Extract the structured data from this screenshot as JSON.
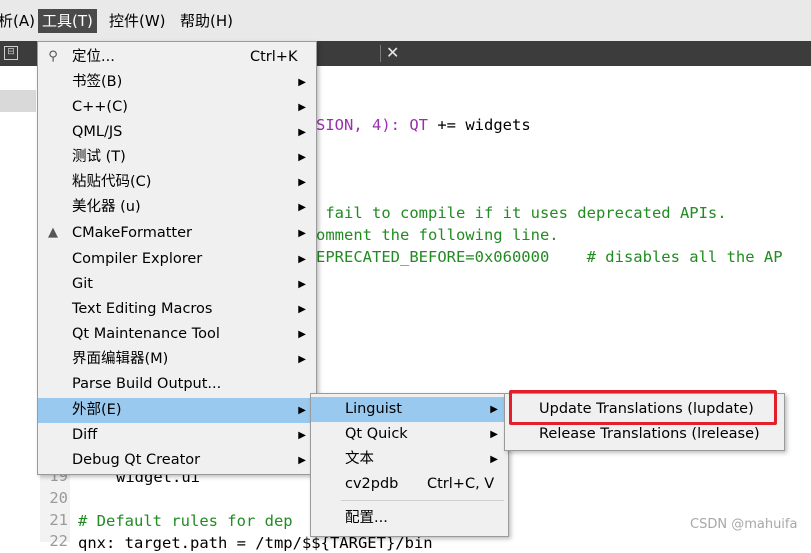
{
  "menubar": {
    "items": [
      {
        "label": "析(A)",
        "underline": "A",
        "active": false
      },
      {
        "label": "工具(T)",
        "underline": "T",
        "active": true
      },
      {
        "label": "控件(W)",
        "underline": "W",
        "active": false
      },
      {
        "label": "帮助(H)",
        "underline": "H",
        "active": false
      }
    ]
  },
  "tabbar": {
    "close_glyph": "✕",
    "split_glyph": "⊟"
  },
  "code": {
    "lines": [
      {
        "text_a": "SION, 4): ",
        "text_b": "QT",
        "text_c": " += widgets"
      },
      {
        "text": " fail to compile if it uses deprecated APIs."
      },
      {
        "text": "omment the following line."
      },
      {
        "text": "EPRECATED_BEFORE=0x060000    # disables all the AP"
      },
      {
        "text": "widget.ui"
      },
      {
        "text": "# Default rules for dep"
      },
      {
        "text": "qnx: target.path = /tmp/$${TARGET}/bin"
      }
    ],
    "line_numbers": [
      "19",
      "20",
      "21",
      "22"
    ]
  },
  "tools_menu": {
    "items": [
      {
        "label": "定位...",
        "shortcut": "Ctrl+K",
        "icon": "search-icon",
        "submenu": false
      },
      {
        "label": "书签(B)",
        "submenu": true
      },
      {
        "label": "C++(C)",
        "submenu": true
      },
      {
        "label": "QML/JS",
        "submenu": true
      },
      {
        "label": "测试 (T)",
        "submenu": true
      },
      {
        "label": "粘贴代码(C)",
        "submenu": true
      },
      {
        "label": "美化器 (u)",
        "submenu": true
      },
      {
        "label": "CMakeFormatter",
        "icon": "cmake-icon",
        "submenu": true
      },
      {
        "label": "Compiler Explorer",
        "submenu": true
      },
      {
        "label": "Git",
        "submenu": true
      },
      {
        "label": "Text Editing Macros",
        "submenu": true
      },
      {
        "label": "Qt Maintenance Tool",
        "submenu": true
      },
      {
        "label": "界面编辑器(M)",
        "submenu": true
      },
      {
        "label": "Parse Build Output...",
        "submenu": false
      },
      {
        "label": "外部(E)",
        "submenu": true,
        "highlighted": true
      },
      {
        "label": "Diff",
        "submenu": true
      },
      {
        "label": "Debug Qt Creator",
        "submenu": true
      }
    ]
  },
  "external_menu": {
    "items": [
      {
        "label": "Linguist",
        "submenu": true,
        "highlighted": true
      },
      {
        "label": "Qt Quick",
        "submenu": true
      },
      {
        "label": "文本",
        "submenu": true
      },
      {
        "label": "cv2pdb",
        "shortcut": "Ctrl+C, V",
        "submenu": false
      },
      {
        "label": "配置..."
      }
    ]
  },
  "linguist_menu": {
    "items": [
      {
        "label": "Update Translations (lupdate)"
      },
      {
        "label": "Release Translations (lrelease)"
      }
    ]
  },
  "watermark": "CSDN @mahuifa",
  "arrow": "▶",
  "colors": {
    "highlight": "#99c9ef",
    "annotation_red": "#e0202a",
    "active_menu": "#4a4a4a"
  }
}
